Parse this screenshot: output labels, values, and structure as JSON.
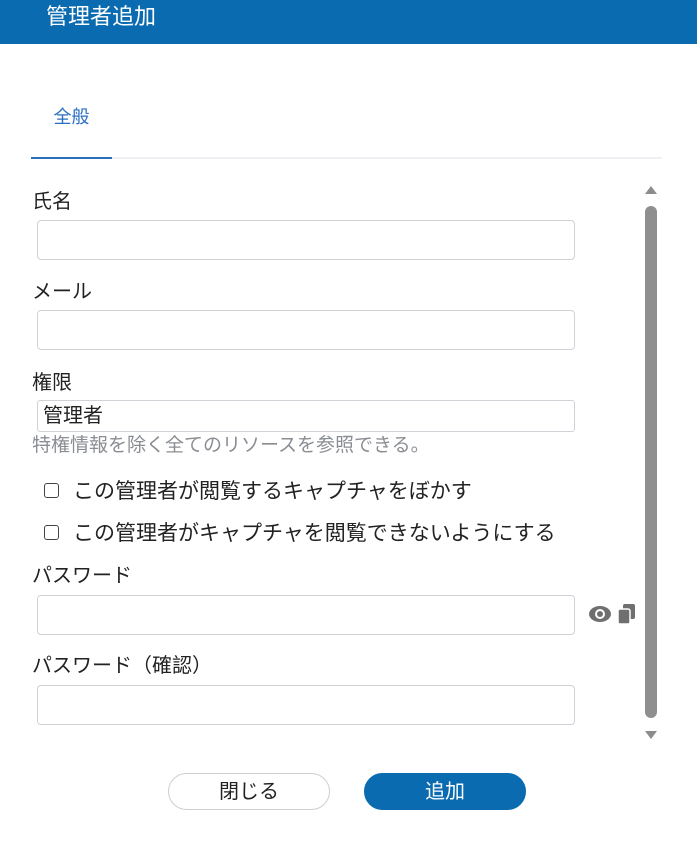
{
  "dialog": {
    "title": "管理者追加"
  },
  "tabs": [
    {
      "label": "全般"
    }
  ],
  "form": {
    "name": {
      "label": "氏名",
      "value": ""
    },
    "email": {
      "label": "メール",
      "value": ""
    },
    "permission": {
      "label": "権限",
      "selected": "管理者",
      "description": "特権情報を除く全てのリソースを参照できる。"
    },
    "checkboxes": [
      {
        "label": "この管理者が閲覧するキャプチャをぼかす",
        "checked": false
      },
      {
        "label": "この管理者がキャプチャを閲覧できないようにする",
        "checked": false
      }
    ],
    "password": {
      "label": "パスワード",
      "value": ""
    },
    "password_confirm": {
      "label": "パスワード（確認）",
      "value": ""
    }
  },
  "icons": {
    "show_password": "eye-icon",
    "copy_password": "copy-icon"
  },
  "colors": {
    "brand": "#0a6bb0",
    "tab_active": "#2a6fc2"
  },
  "buttons": {
    "close": "閉じる",
    "add": "追加"
  }
}
